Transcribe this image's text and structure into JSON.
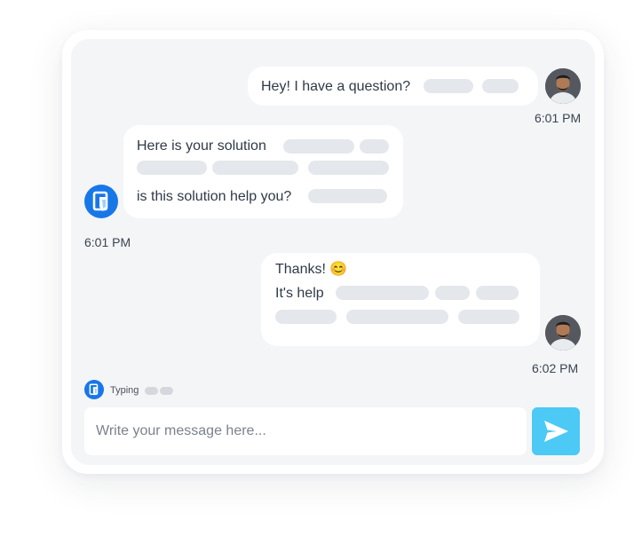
{
  "messages": {
    "m1": {
      "text": "Hey! I have a question?",
      "time": "6:01 PM",
      "sender": "user"
    },
    "m2": {
      "line1": "Here is your solution",
      "line3": "is this solution help you?",
      "time": "6:01 PM",
      "sender": "bot"
    },
    "m3": {
      "line1": "Thanks! 😊",
      "line2": "It's help",
      "time": "6:02 PM",
      "sender": "user"
    }
  },
  "typing": {
    "label": "Typing"
  },
  "composer": {
    "placeholder": "Write your message here..."
  },
  "colors": {
    "accent": "#1877e8",
    "send": "#4cc9f5",
    "panel": "#f4f5f7"
  },
  "icons": {
    "send": "send-icon",
    "bot": "bot-logo-icon",
    "user": "user-avatar"
  }
}
